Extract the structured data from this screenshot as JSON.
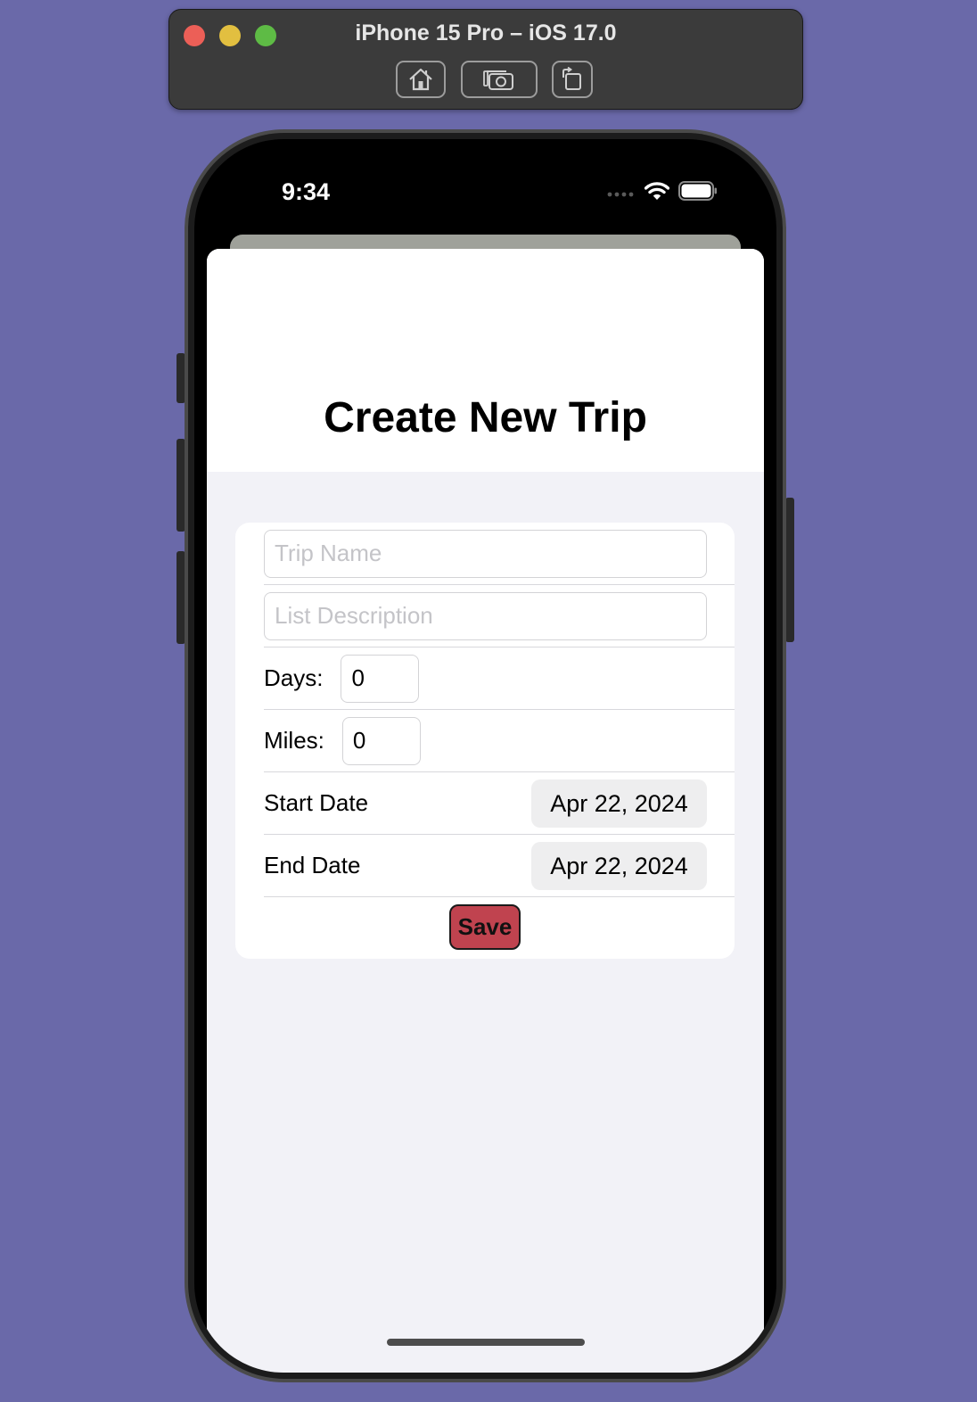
{
  "simulator": {
    "title": "iPhone 15 Pro – iOS 17.0",
    "buttons": [
      "home-icon",
      "screenshot-icon",
      "rotate-icon"
    ]
  },
  "status_bar": {
    "time": "9:34",
    "icons": [
      "cellular-dots-icon",
      "wifi-icon",
      "battery-icon"
    ]
  },
  "sheet": {
    "title": "Create New Trip"
  },
  "form": {
    "trip_name": {
      "value": "",
      "placeholder": "Trip Name"
    },
    "list_description": {
      "value": "",
      "placeholder": "List Description"
    },
    "days": {
      "label": "Days:",
      "value": "0"
    },
    "miles": {
      "label": "Miles:",
      "value": "0"
    },
    "start_date": {
      "label": "Start Date",
      "value": "Apr 22, 2024"
    },
    "end_date": {
      "label": "End Date",
      "value": "Apr 22, 2024"
    },
    "save_label": "Save"
  },
  "colors": {
    "desktop_background": "#6a69a9",
    "save_button": "#c0434f",
    "grouped_background": "#f2f2f7"
  }
}
